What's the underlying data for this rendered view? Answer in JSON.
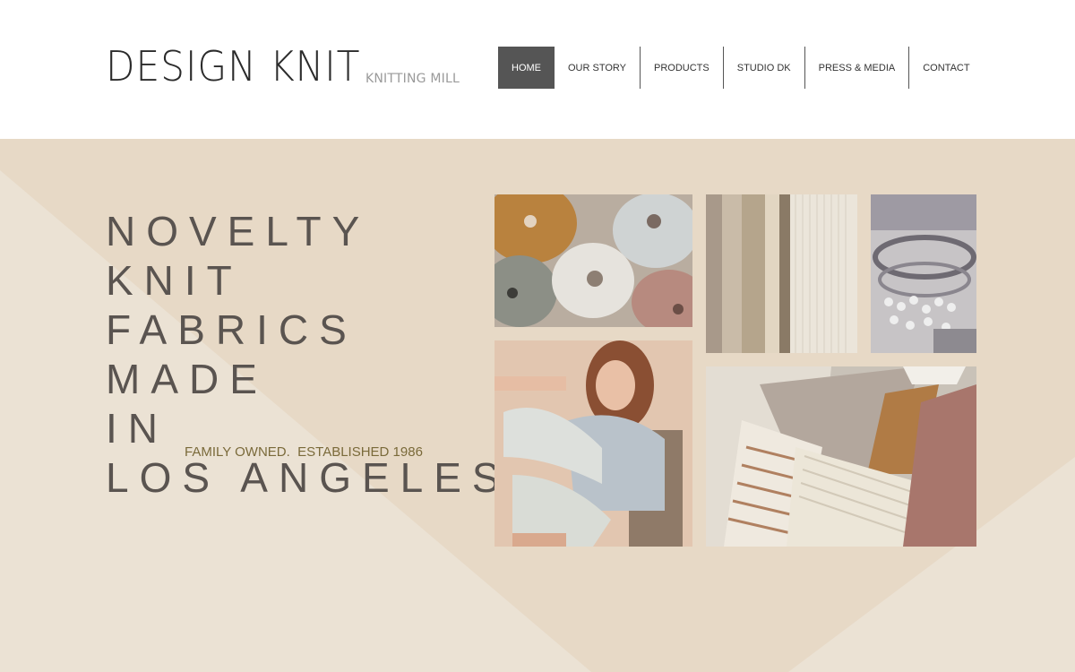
{
  "brand": {
    "name": "DESIGN KNIT",
    "subtitle": "KNITTING MILL"
  },
  "nav": {
    "items": [
      {
        "label": "HOME",
        "active": true
      },
      {
        "label": "OUR STORY",
        "active": false
      },
      {
        "label": "PRODUCTS",
        "active": false
      },
      {
        "label": "STUDIO DK",
        "active": false
      },
      {
        "label": "PRESS & MEDIA",
        "active": false
      },
      {
        "label": "CONTACT",
        "active": false
      }
    ]
  },
  "hero": {
    "headline_lines": [
      "NOVELTY",
      "KNIT",
      "FABRICS",
      "MADE",
      "IN",
      "LOS ANGELES"
    ],
    "tagline": "FAMILY OWNED.  ESTABLISHED 1986"
  },
  "colors": {
    "hero_bg": "#e7d9c6",
    "nav_active": "#555555",
    "headline": "#5a5450",
    "tagline": "#7a6a3a"
  }
}
